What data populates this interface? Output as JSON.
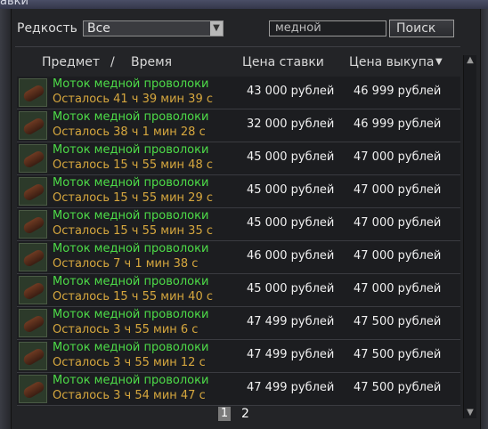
{
  "window": {
    "title": "авки"
  },
  "filter": {
    "rarity_label": "Редкость",
    "rarity_value": "Все",
    "search_value": "медной",
    "search_button": "Поиск"
  },
  "columns": {
    "item": "Предмет",
    "slash": "/",
    "time": "Время",
    "bid": "Цена ставки",
    "buyout": "Цена выкупа",
    "sort_indicator": "▼"
  },
  "rows": [
    {
      "name": "Моток медной проволоки",
      "time": "Осталось 41 ч 39 мин 39 с",
      "bid": "43 000 рублей",
      "buyout": "46 999 рублей"
    },
    {
      "name": "Моток медной проволоки",
      "time": "Осталось 38 ч 1 мин 28 с",
      "bid": "32 000 рублей",
      "buyout": "46 999 рублей"
    },
    {
      "name": "Моток медной проволоки",
      "time": "Осталось 15 ч 55 мин 48 с",
      "bid": "45 000 рублей",
      "buyout": "47 000 рублей"
    },
    {
      "name": "Моток медной проволоки",
      "time": "Осталось 15 ч 55 мин 29 с",
      "bid": "45 000 рублей",
      "buyout": "47 000 рублей"
    },
    {
      "name": "Моток медной проволоки",
      "time": "Осталось 15 ч 55 мин 35 с",
      "bid": "45 000 рублей",
      "buyout": "47 000 рублей"
    },
    {
      "name": "Моток медной проволоки",
      "time": "Осталось 7 ч 1 мин 38 с",
      "bid": "46 000 рублей",
      "buyout": "47 000 рублей"
    },
    {
      "name": "Моток медной проволоки",
      "time": "Осталось 15 ч 55 мин 40 с",
      "bid": "45 000 рублей",
      "buyout": "47 000 рублей"
    },
    {
      "name": "Моток медной проволоки",
      "time": "Осталось 3 ч 55 мин 6 с",
      "bid": "47 499 рублей",
      "buyout": "47 500 рублей"
    },
    {
      "name": "Моток медной проволоки",
      "time": "Осталось 3 ч 55 мин 12 с",
      "bid": "47 499 рублей",
      "buyout": "47 500 рублей"
    },
    {
      "name": "Моток медной проволоки",
      "time": "Осталось 3 ч 54 мин 47 с",
      "bid": "47 499 рублей",
      "buyout": "47 500 рублей"
    }
  ],
  "pagination": {
    "current": "1",
    "next": "2"
  },
  "scrollbar": {
    "up": "▲",
    "down": "▼"
  }
}
